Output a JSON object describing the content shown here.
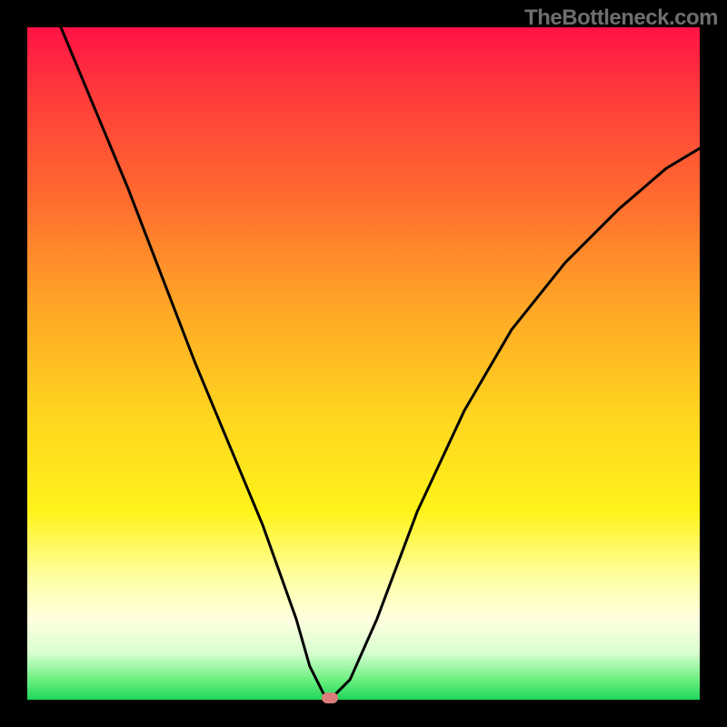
{
  "watermark": "TheBottleneck.com",
  "colors": {
    "background": "#000000",
    "curve": "#000000",
    "marker": "#d87d7a",
    "gradient_top": "#ff1245",
    "gradient_bottom": "#1fd65a"
  },
  "chart_data": {
    "type": "line",
    "title": "",
    "xlabel": "",
    "ylabel": "",
    "xlim": [
      0,
      100
    ],
    "ylim": [
      0,
      100
    ],
    "grid": false,
    "series": [
      {
        "name": "bottleneck-curve",
        "x": [
          5,
          10,
          15,
          20,
          25,
          30,
          35,
          40,
          42,
          44,
          45,
          48,
          52,
          58,
          65,
          72,
          80,
          88,
          95,
          100
        ],
        "y": [
          100,
          88,
          76,
          63,
          50,
          38,
          26,
          12,
          5,
          1,
          0,
          3,
          12,
          28,
          43,
          55,
          65,
          73,
          79,
          82
        ]
      }
    ],
    "annotations": [
      {
        "name": "minimum-marker",
        "x": 45,
        "y": 0
      }
    ],
    "background_gradient": {
      "type": "vertical",
      "stops": [
        {
          "pos": 0,
          "color": "#ff1245"
        },
        {
          "pos": 50,
          "color": "#ffd61f"
        },
        {
          "pos": 85,
          "color": "#ffffe0"
        },
        {
          "pos": 100,
          "color": "#1fd65a"
        }
      ]
    }
  }
}
